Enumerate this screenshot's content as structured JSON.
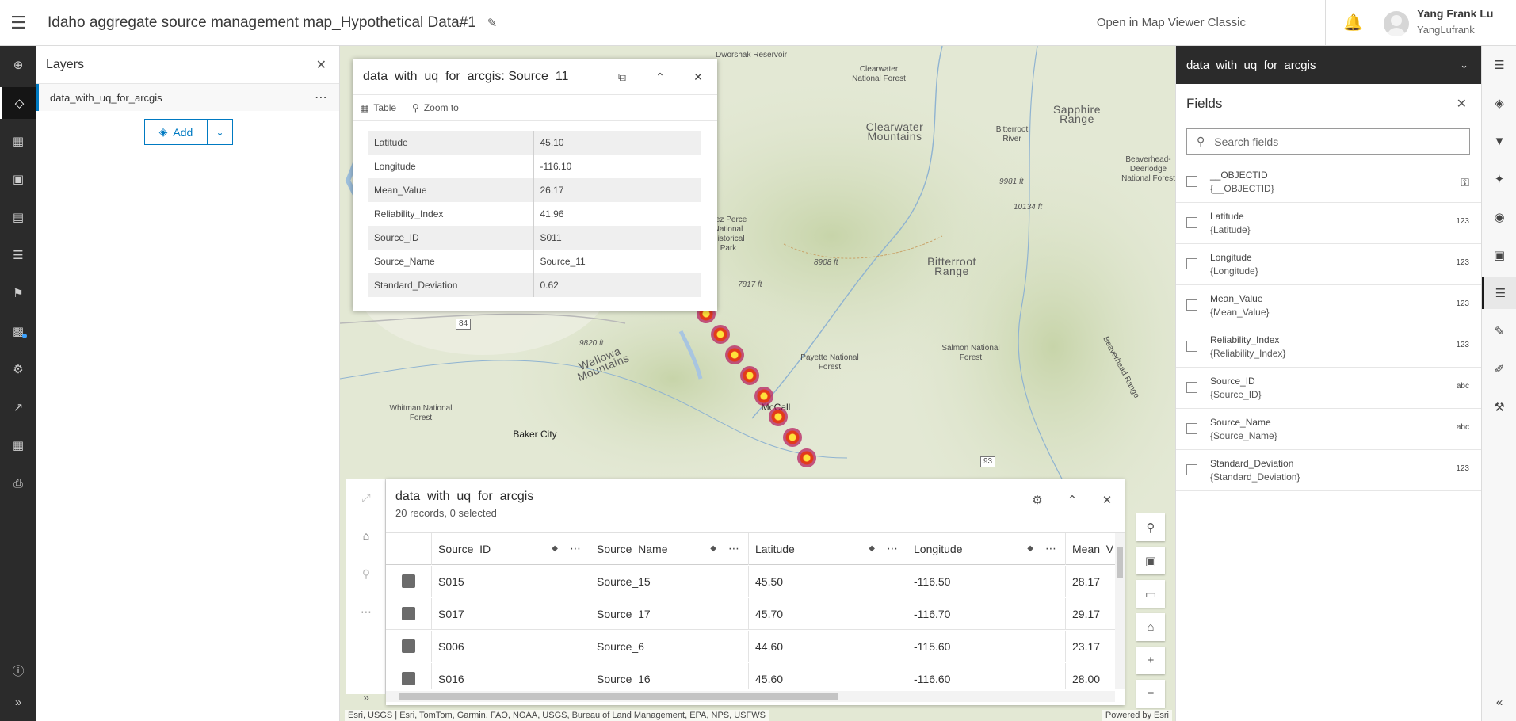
{
  "header": {
    "title": "Idaho aggregate source management map_Hypothetical Data#1",
    "open_classic": "Open in Map Viewer Classic",
    "user_name": "Yang Frank Lu",
    "user_handle": "YangLufrank"
  },
  "layers_panel": {
    "title": "Layers",
    "layer_name": "data_with_uq_for_arcgis",
    "add_label": "Add"
  },
  "map": {
    "labels": [
      "Dworshak Reservoir",
      "Clearwater National Forest",
      "Clearwater Mountains",
      "Sapphire Range",
      "Beaverhead-Deerlodge National Forest",
      "Bitterroot Range",
      "Bitterroot River",
      "Payette National Forest",
      "Salmon National Forest",
      "Wallowa Mountains",
      "Whitman National Forest",
      "Baker City",
      "McCall",
      "Nez Perce National Historical Park",
      "Beaverhead Range"
    ],
    "elevations": [
      "9981 ft",
      "10134 ft",
      "8908 ft",
      "7817 ft",
      "9820 ft"
    ],
    "shields": [
      "84",
      "93"
    ],
    "attribution": "Esri, USGS | Esri, TomTom, Garmin, FAO, NOAA, USGS, Bureau of Land Management, EPA, NPS, USFWS",
    "powered": "Powered by Esri"
  },
  "popup": {
    "title": "data_with_uq_for_arcgis: Source_11",
    "table_label": "Table",
    "zoom_label": "Zoom to",
    "attributes": [
      {
        "k": "Latitude",
        "v": "45.10"
      },
      {
        "k": "Longitude",
        "v": "-116.10"
      },
      {
        "k": "Mean_Value",
        "v": "26.17"
      },
      {
        "k": "Reliability_Index",
        "v": "41.96"
      },
      {
        "k": "Source_ID",
        "v": "S011"
      },
      {
        "k": "Source_Name",
        "v": "Source_11"
      },
      {
        "k": "Standard_Deviation",
        "v": "0.62"
      }
    ]
  },
  "table": {
    "title": "data_with_uq_for_arcgis",
    "subtitle": "20 records, 0 selected",
    "columns": [
      "Source_ID",
      "Source_Name",
      "Latitude",
      "Longitude",
      "Mean_V"
    ],
    "rows": [
      [
        "S015",
        "Source_15",
        "45.50",
        "-116.50",
        "28.17"
      ],
      [
        "S017",
        "Source_17",
        "45.70",
        "-116.70",
        "29.17"
      ],
      [
        "S006",
        "Source_6",
        "44.60",
        "-115.60",
        "23.17"
      ],
      [
        "S016",
        "Source_16",
        "45.60",
        "-116.60",
        "28.00"
      ]
    ]
  },
  "fields_panel": {
    "layer": "data_with_uq_for_arcgis",
    "title": "Fields",
    "search_placeholder": "Search fields",
    "fields": [
      {
        "name": "__OBJECTID",
        "expr": "{__OBJECTID}",
        "type": "key-icon"
      },
      {
        "name": "Latitude",
        "expr": "{Latitude}",
        "type": "123"
      },
      {
        "name": "Longitude",
        "expr": "{Longitude}",
        "type": "123"
      },
      {
        "name": "Mean_Value",
        "expr": "{Mean_Value}",
        "type": "123"
      },
      {
        "name": "Reliability_Index",
        "expr": "{Reliability_Index}",
        "type": "123"
      },
      {
        "name": "Source_ID",
        "expr": "{Source_ID}",
        "type": "abc"
      },
      {
        "name": "Source_Name",
        "expr": "{Source_Name}",
        "type": "abc"
      },
      {
        "name": "Standard_Deviation",
        "expr": "{Standard_Deviation}",
        "type": "123"
      }
    ]
  },
  "colors": {
    "accent": "#007ac2",
    "dark_bar": "#2b2b2b"
  }
}
